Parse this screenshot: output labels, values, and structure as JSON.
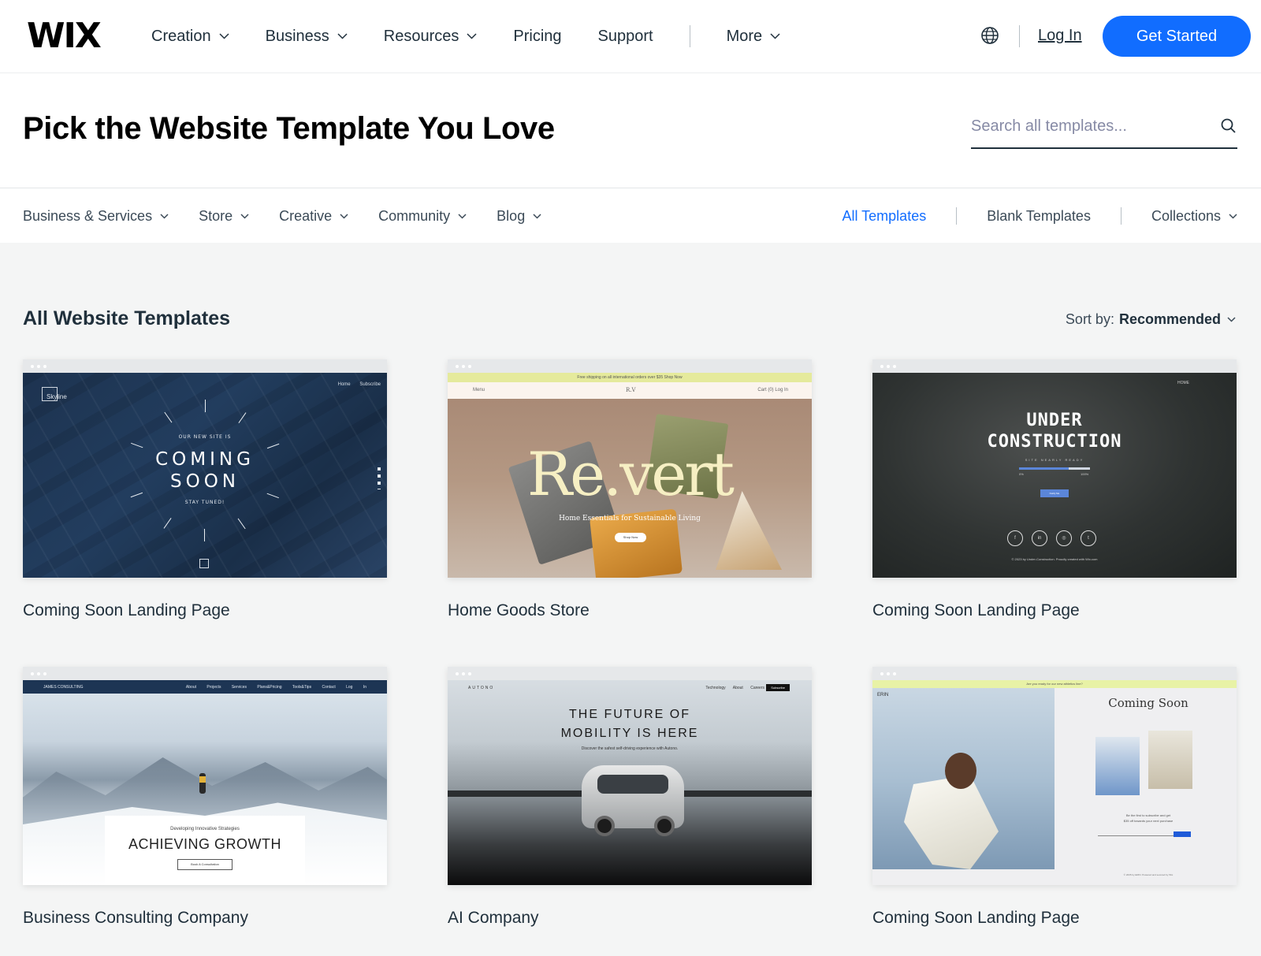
{
  "nav": {
    "logo": "WIX",
    "links": [
      {
        "label": "Creation",
        "has_dropdown": true
      },
      {
        "label": "Business",
        "has_dropdown": true
      },
      {
        "label": "Resources",
        "has_dropdown": true
      },
      {
        "label": "Pricing",
        "has_dropdown": false
      },
      {
        "label": "Support",
        "has_dropdown": false
      }
    ],
    "more_label": "More",
    "login_label": "Log In",
    "cta_label": "Get Started",
    "accent_color": "#116dff"
  },
  "hero": {
    "title": "Pick the Website Template You Love",
    "search_placeholder": "Search all templates..."
  },
  "categories": {
    "items": [
      "Business & Services",
      "Store",
      "Creative",
      "Community",
      "Blog"
    ],
    "all_templates": "All Templates",
    "blank_templates": "Blank Templates",
    "collections": "Collections"
  },
  "listing": {
    "title": "All Website Templates",
    "sort_label": "Sort by:",
    "sort_value": "Recommended"
  },
  "templates": [
    {
      "name": "Coming Soon Landing Page"
    },
    {
      "name": "Home Goods Store"
    },
    {
      "name": "Coming Soon Landing Page"
    },
    {
      "name": "Business Consulting Company"
    },
    {
      "name": "AI Company"
    },
    {
      "name": "Coming Soon Landing Page"
    }
  ],
  "thumbs": {
    "t1": {
      "logo": "Skyline",
      "nav": "Home Subscribe",
      "kicker": "OUR NEW SITE IS",
      "line1": "COMING",
      "line2": "SOON",
      "stay": "STAY TUNED!"
    },
    "t2": {
      "banner": "Free shipping on all international orders over $35 Shop Now",
      "menu": "Menu",
      "brand": "R.V",
      "cart": "Cart (0)   Log In",
      "word": "Re.vert",
      "sub": "Home Essentials for Sustainable Living",
      "btn": "Shop Now"
    },
    "t3": {
      "home": "HOME",
      "line1": "UNDER",
      "line2": "CONSTRUCTION",
      "sub": "SITE NEARLY READY",
      "p0": "0%",
      "p100": "100%",
      "btn": "Notify Me",
      "copy": "© 2023 by Under-Construction. Proudly created with Wix.com",
      "socials": [
        "f",
        "in",
        "◎",
        "t"
      ]
    },
    "t4": {
      "brand": "JAMES CONSULTING",
      "nav": "About Projects Services Plans&Pricing Tools&Tips Contact Log In",
      "kicker": "Developing Innovative Strategies",
      "headline": "ACHIEVING GROWTH",
      "btn": "Book A Consultation"
    },
    "t5": {
      "brand": "AUTONO",
      "nav": "Technology About Careers",
      "btn": "Subscribe",
      "line1": "THE FUTURE OF",
      "line2": "MOBILITY IS HERE",
      "sub": "Discover the safest self-driving experience with Autono."
    },
    "t6": {
      "banner": "Are you ready for our new athletics line?",
      "brand": "ERIN",
      "title": "Coming Soon",
      "text1": "Be the first to subscribe and get",
      "text2": "$35 off towards your next purchase",
      "foot": "© 2035 by ERIN. Powered and secured by Wix"
    }
  }
}
